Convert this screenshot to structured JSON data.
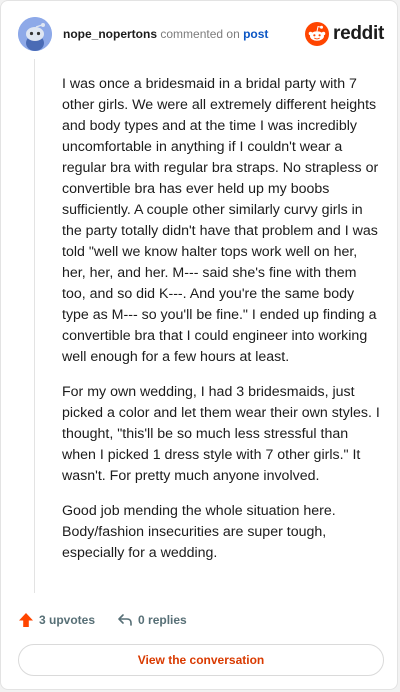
{
  "comment": {
    "username": "nope_nopertons",
    "commented_on": "commented on",
    "post_link": "post",
    "paragraphs": [
      "I was once a bridesmaid in a bridal party with 7 other girls. We were all extremely different heights and body types and at the time I was incredibly uncomfortable in anything if I couldn't wear a regular bra with regular bra straps. No strapless or convertible bra has ever held up my boobs sufficiently. A couple other similarly curvy girls in the party totally didn't have that problem and I was told \"well we know halter tops work well on her, her, her, and her. M--- said she's fine with them too, and so did K---. And you're the same body type as M--- so you'll be fine.\" I ended up finding a convertible bra that I could engineer into working well enough for a few hours at least.",
      "For my own wedding, I had 3 bridesmaids, just picked a color and let them wear their own styles. I thought, \"this'll be so much less stressful than when I picked 1 dress style with 7 other girls.\" It wasn't. For pretty much anyone involved.",
      "Good job mending the whole situation here. Body/fashion insecurities are super tough, especially for a wedding."
    ]
  },
  "brand": {
    "logo_text": "reddit",
    "logo_icon": "reddit-snoo-icon",
    "accent_color": "#ff4500"
  },
  "actions": {
    "upvotes": "3 upvotes",
    "upvote_icon": "upvote-arrow-icon",
    "upvote_color": "#ff4500",
    "replies": "0 replies",
    "reply_icon": "reply-arrow-icon"
  },
  "footer": {
    "view_conversation": "View the conversation",
    "link_color": "#d93a00"
  }
}
